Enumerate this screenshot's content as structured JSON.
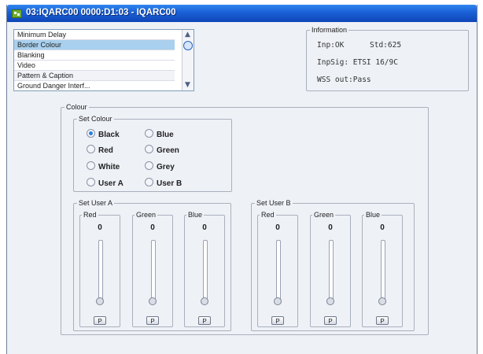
{
  "window": {
    "title": "03:IQARC00  0000:D1:03  - IQARC00"
  },
  "menu_list": {
    "items": [
      "Minimum Delay",
      "Border Colour",
      "Blanking",
      "Video",
      "Pattern & Caption",
      "Ground Danger Interf..."
    ],
    "selected": "Border Colour"
  },
  "information": {
    "legend": "Information",
    "inp": "Inp:OK",
    "std": "Std:625",
    "inpsig": "InpSig: ETSI 16/9C",
    "wss": "WSS out:Pass"
  },
  "colour": {
    "legend": "Colour",
    "set_colour": {
      "legend": "Set Colour",
      "options": [
        "Black",
        "Blue",
        "Red",
        "Green",
        "White",
        "Grey",
        "User A",
        "User B"
      ],
      "selected": "Black"
    },
    "user_a": {
      "legend": "Set User A",
      "channels": [
        {
          "label": "Red",
          "value": "0",
          "button": "P"
        },
        {
          "label": "Green",
          "value": "0",
          "button": "P"
        },
        {
          "label": "Blue",
          "value": "0",
          "button": "P"
        }
      ]
    },
    "user_b": {
      "legend": "Set User B",
      "channels": [
        {
          "label": "Red",
          "value": "0",
          "button": "P"
        },
        {
          "label": "Green",
          "value": "0",
          "button": "P"
        },
        {
          "label": "Blue",
          "value": "0",
          "button": "P"
        }
      ]
    }
  },
  "colors": {
    "titlebar": "#1a5fd6",
    "selection": "#a9d0ee",
    "window_bg": "#eef1f6",
    "radio_checked": "#2a7fe0"
  },
  "icons": {
    "app": "app-window-icon"
  }
}
